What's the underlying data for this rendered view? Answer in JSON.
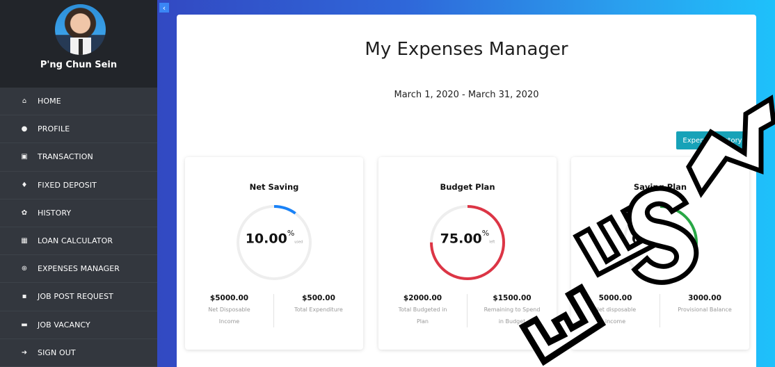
{
  "sidebar": {
    "user_name": "P'ng Chun Sein",
    "items": [
      {
        "label": "HOME",
        "icon": "home-icon",
        "glyph": "⌂"
      },
      {
        "label": "PROFILE",
        "icon": "user-icon",
        "glyph": "●"
      },
      {
        "label": "TRANSACTION",
        "icon": "money-icon",
        "glyph": "▣"
      },
      {
        "label": "FIXED DEPOSIT",
        "icon": "trophy-icon",
        "glyph": "♦"
      },
      {
        "label": "HISTORY",
        "icon": "gear-icon",
        "glyph": "✿"
      },
      {
        "label": "LOAN CALCULATOR",
        "icon": "calculator-icon",
        "glyph": "▦"
      },
      {
        "label": "EXPENSES MANAGER",
        "icon": "globe-icon",
        "glyph": "⊕"
      },
      {
        "label": "JOB POST REQUEST",
        "icon": "id-card-icon",
        "glyph": "▪"
      },
      {
        "label": "JOB VACANCY",
        "icon": "briefcase-icon",
        "glyph": "▬"
      },
      {
        "label": "SIGN OUT",
        "icon": "sign-out-icon",
        "glyph": "➜"
      }
    ]
  },
  "main": {
    "toggle_glyph": "‹",
    "title": "My Expenses Manager",
    "period": "March 1, 2020 - March 31, 2020",
    "history_button": "Expenses history",
    "cards": [
      {
        "title": "Net Saving",
        "percent": "10.00",
        "percent_value": 10,
        "percent_sign": "%",
        "percent_note": "used",
        "color": "#1a82f7",
        "left_value": "$5000.00",
        "left_caption": "Net Disposable Income",
        "right_value": "$500.00",
        "right_caption": "Total Expenditure"
      },
      {
        "title": "Budget Plan",
        "percent": "75.00",
        "percent_value": 75,
        "percent_sign": "%",
        "percent_note": "left",
        "color": "#dc3545",
        "left_value": "$2000.00",
        "left_caption": "Total Budgeted in Plan",
        "right_value": "$1500.00",
        "right_caption": "Remaining to Spend in Budget"
      },
      {
        "title": "Saving Plan",
        "percent": "60.00",
        "percent_value": 60,
        "percent_sign": "%",
        "percent_note": "used",
        "color": "#28a745",
        "left_value": "5000.00",
        "left_caption": "Net disposable income",
        "right_value": "3000.00",
        "right_caption": "Provisional Balance"
      }
    ]
  },
  "watermark": "ETSM"
}
